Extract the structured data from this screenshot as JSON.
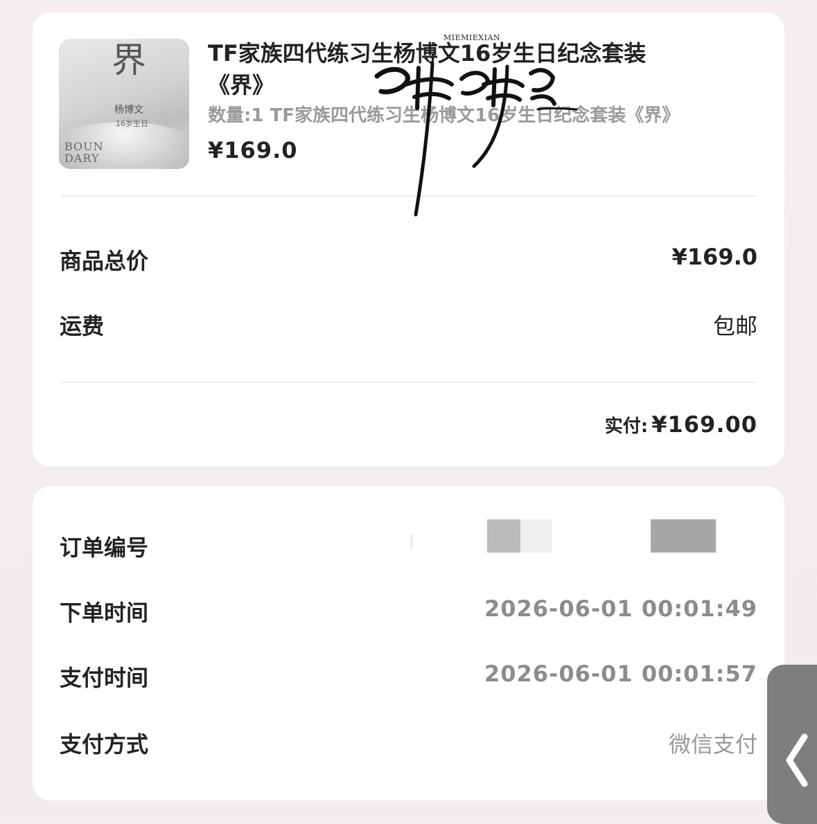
{
  "product": {
    "title_line1": "TF家族四代练习生杨博文16岁生日纪念套装",
    "title_line2": "《界》",
    "quantity_desc": "数量:1 TF家族四代练习生杨博文16岁生日纪念套装《界》",
    "price": "¥169.0",
    "cover": {
      "artist_name": "杨博文",
      "subtitle": "16岁生日",
      "boundary_text_line1": "BOUN",
      "boundary_text_line2": "DARY"
    }
  },
  "summary": {
    "total_label": "商品总价",
    "total_value": "¥169.0",
    "shipping_label": "运费",
    "shipping_value": "包邮",
    "paid_label": "实付:",
    "paid_value": "¥169.00"
  },
  "order": {
    "number_label": "订单编号",
    "placed_label": "下单时间",
    "placed_value": "2026-06-01 00:01:49",
    "paid_time_label": "支付时间",
    "paid_time_value": "2026-06-01 00:01:57",
    "method_label": "支付方式",
    "method_value": "微信支付"
  },
  "watermark": {
    "latin": "MIEMIEXIAN",
    "icon": "calligraphy-signature"
  },
  "icons": {
    "side_tab": "chevron-left-icon"
  },
  "colors": {
    "background": "#f3eef1",
    "card": "#ffffff",
    "muted_text": "#8c8c8c",
    "side_tab": "#7e7e7e"
  }
}
